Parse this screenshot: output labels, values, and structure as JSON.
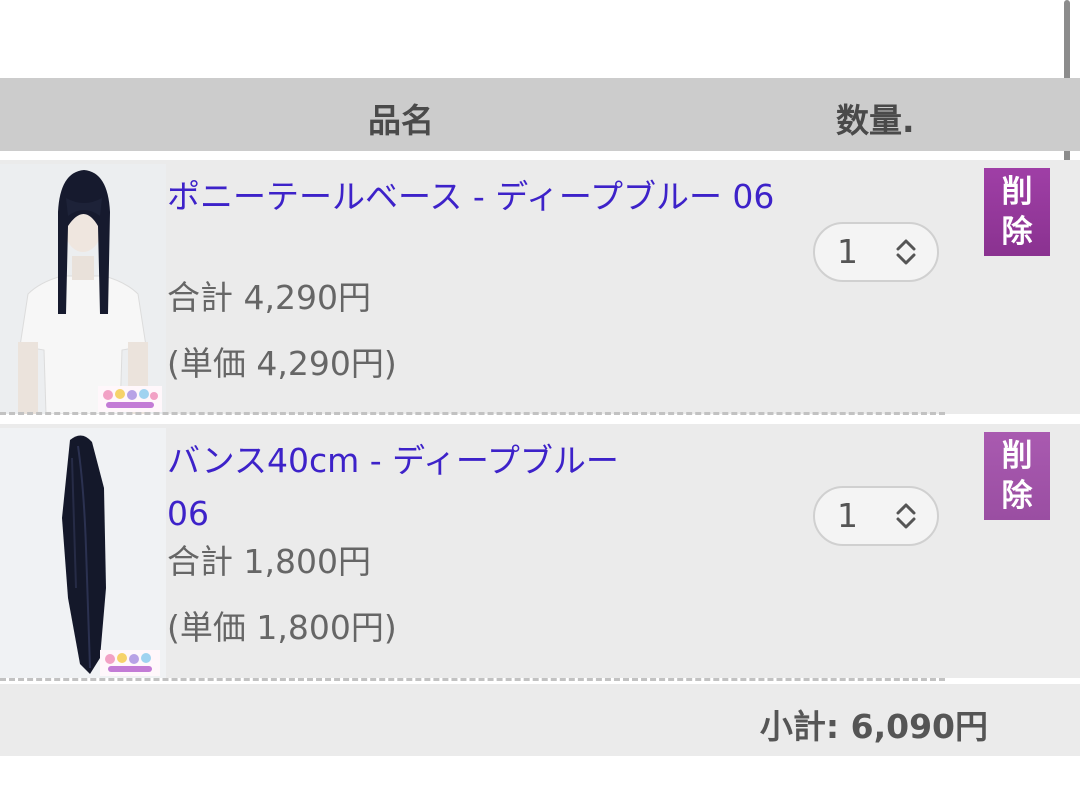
{
  "header": {
    "name_label": "品名",
    "quantity_label": "数量."
  },
  "items": [
    {
      "name": "ポニーテールベース - ディープブルー 06",
      "total": "合計 4,290円",
      "unit_price": "(単価 4,290円)",
      "quantity": "1",
      "delete_label_1": "削",
      "delete_label_2": "除",
      "thumbnail": "wig-on-mannequin"
    },
    {
      "name": "バンス40cm - ディープブルー 06",
      "total": "合計 1,800円",
      "unit_price": "(単価 1,800円)",
      "quantity": "1",
      "delete_label_1": "削",
      "delete_label_2": "除",
      "thumbnail": "long-hair-ponytail"
    }
  ],
  "subtotal": "小計: 6,090円",
  "colors": {
    "link": "#3d22c9",
    "delete": "#9a3fa0",
    "header_bg": "#cccccc",
    "row_bg": "#ebebeb"
  }
}
